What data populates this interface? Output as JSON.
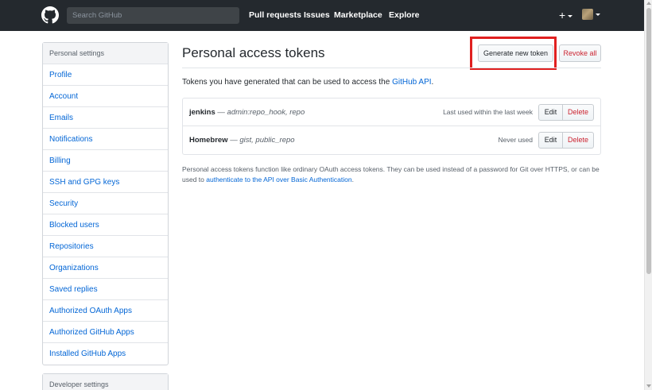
{
  "header": {
    "search_placeholder": "Search GitHub",
    "nav": [
      "Pull requests",
      "Issues",
      "Marketplace",
      "Explore"
    ],
    "plus_label": "+",
    "icons": {
      "logo": "github-octocat-icon",
      "plus": "plus-icon",
      "avatar": "user-avatar"
    }
  },
  "sidebar": {
    "heading": "Personal settings",
    "items": [
      "Profile",
      "Account",
      "Emails",
      "Notifications",
      "Billing",
      "SSH and GPG keys",
      "Security",
      "Blocked users",
      "Repositories",
      "Organizations",
      "Saved replies",
      "Authorized OAuth Apps",
      "Authorized GitHub Apps",
      "Installed GitHub Apps"
    ],
    "developer_heading": "Developer settings"
  },
  "main": {
    "title": "Personal access tokens",
    "generate_button": "Generate new token",
    "revoke_button": "Revoke all",
    "intro_text": "Tokens you have generated that can be used to access the ",
    "intro_link": "GitHub API",
    "intro_end": ".",
    "tokens": [
      {
        "name": "jenkins",
        "sep": " — ",
        "scopes": "admin:repo_hook, repo",
        "last_used": "Last used within the last week",
        "edit": "Edit",
        "delete": "Delete"
      },
      {
        "name": "Homebrew",
        "sep": " — ",
        "scopes": "gist, public_repo",
        "last_used": "Never used",
        "edit": "Edit",
        "delete": "Delete"
      }
    ],
    "note_text": "Personal access tokens function like ordinary OAuth access tokens. They can be used instead of a password for Git over HTTPS, or can be used to ",
    "note_link": "authenticate to the API over Basic Authentication",
    "note_end": "."
  },
  "colors": {
    "header_bg": "#24292e",
    "link": "#0366d6",
    "danger": "#cb2431",
    "highlight": "#e02020"
  }
}
